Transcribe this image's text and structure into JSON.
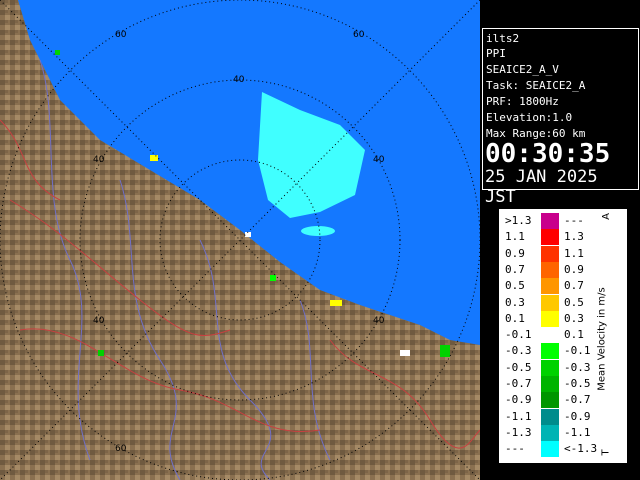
{
  "header": {
    "station": "ilts2",
    "product": "PPI",
    "volume": "SEAICE2_A_V",
    "task": "Task: SEAICE2_A",
    "prf": "PRF: 1800Hz",
    "elevation": "Elevation:1.0",
    "max_range": "Max Range:60 km",
    "time": "00:30:35",
    "date": "25 JAN 2025 JST"
  },
  "range_labels": [
    "60",
    "60",
    "40",
    "40",
    "40",
    "40",
    "40",
    "60"
  ],
  "legend": {
    "title": "Mean Velocity in m/s",
    "unit_top": "A",
    "unit_bottom": "T",
    "rows": [
      {
        "lo": ">1.3",
        "hi": "---",
        "color": "#c8008c"
      },
      {
        "lo": "1.1",
        "hi": "1.3",
        "color": "#ff0000"
      },
      {
        "lo": "0.9",
        "hi": "1.1",
        "color": "#ff3200"
      },
      {
        "lo": "0.7",
        "hi": "0.9",
        "color": "#ff6400"
      },
      {
        "lo": "0.5",
        "hi": "0.7",
        "color": "#ff9600"
      },
      {
        "lo": "0.3",
        "hi": "0.5",
        "color": "#ffc800"
      },
      {
        "lo": "0.1",
        "hi": "0.3",
        "color": "#ffff00"
      },
      {
        "lo": "-0.1",
        "hi": "0.1",
        "color": "#ffffff"
      },
      {
        "lo": "-0.3",
        "hi": "-0.1",
        "color": "#00ff00"
      },
      {
        "lo": "-0.5",
        "hi": "-0.3",
        "color": "#00d200"
      },
      {
        "lo": "-0.7",
        "hi": "-0.5",
        "color": "#00b400"
      },
      {
        "lo": "-0.9",
        "hi": "-0.7",
        "color": "#009600"
      },
      {
        "lo": "-1.1",
        "hi": "-0.9",
        "color": "#008c8c"
      },
      {
        "lo": "-1.3",
        "hi": "-1.1",
        "color": "#00b4b4"
      },
      {
        "lo": "---",
        "hi": "<-1.3",
        "color": "#00ffff"
      }
    ]
  },
  "colors": {
    "sea": "#1478ff",
    "land": "#8c7250",
    "echo": "#40ffff",
    "rings": "#000000"
  }
}
